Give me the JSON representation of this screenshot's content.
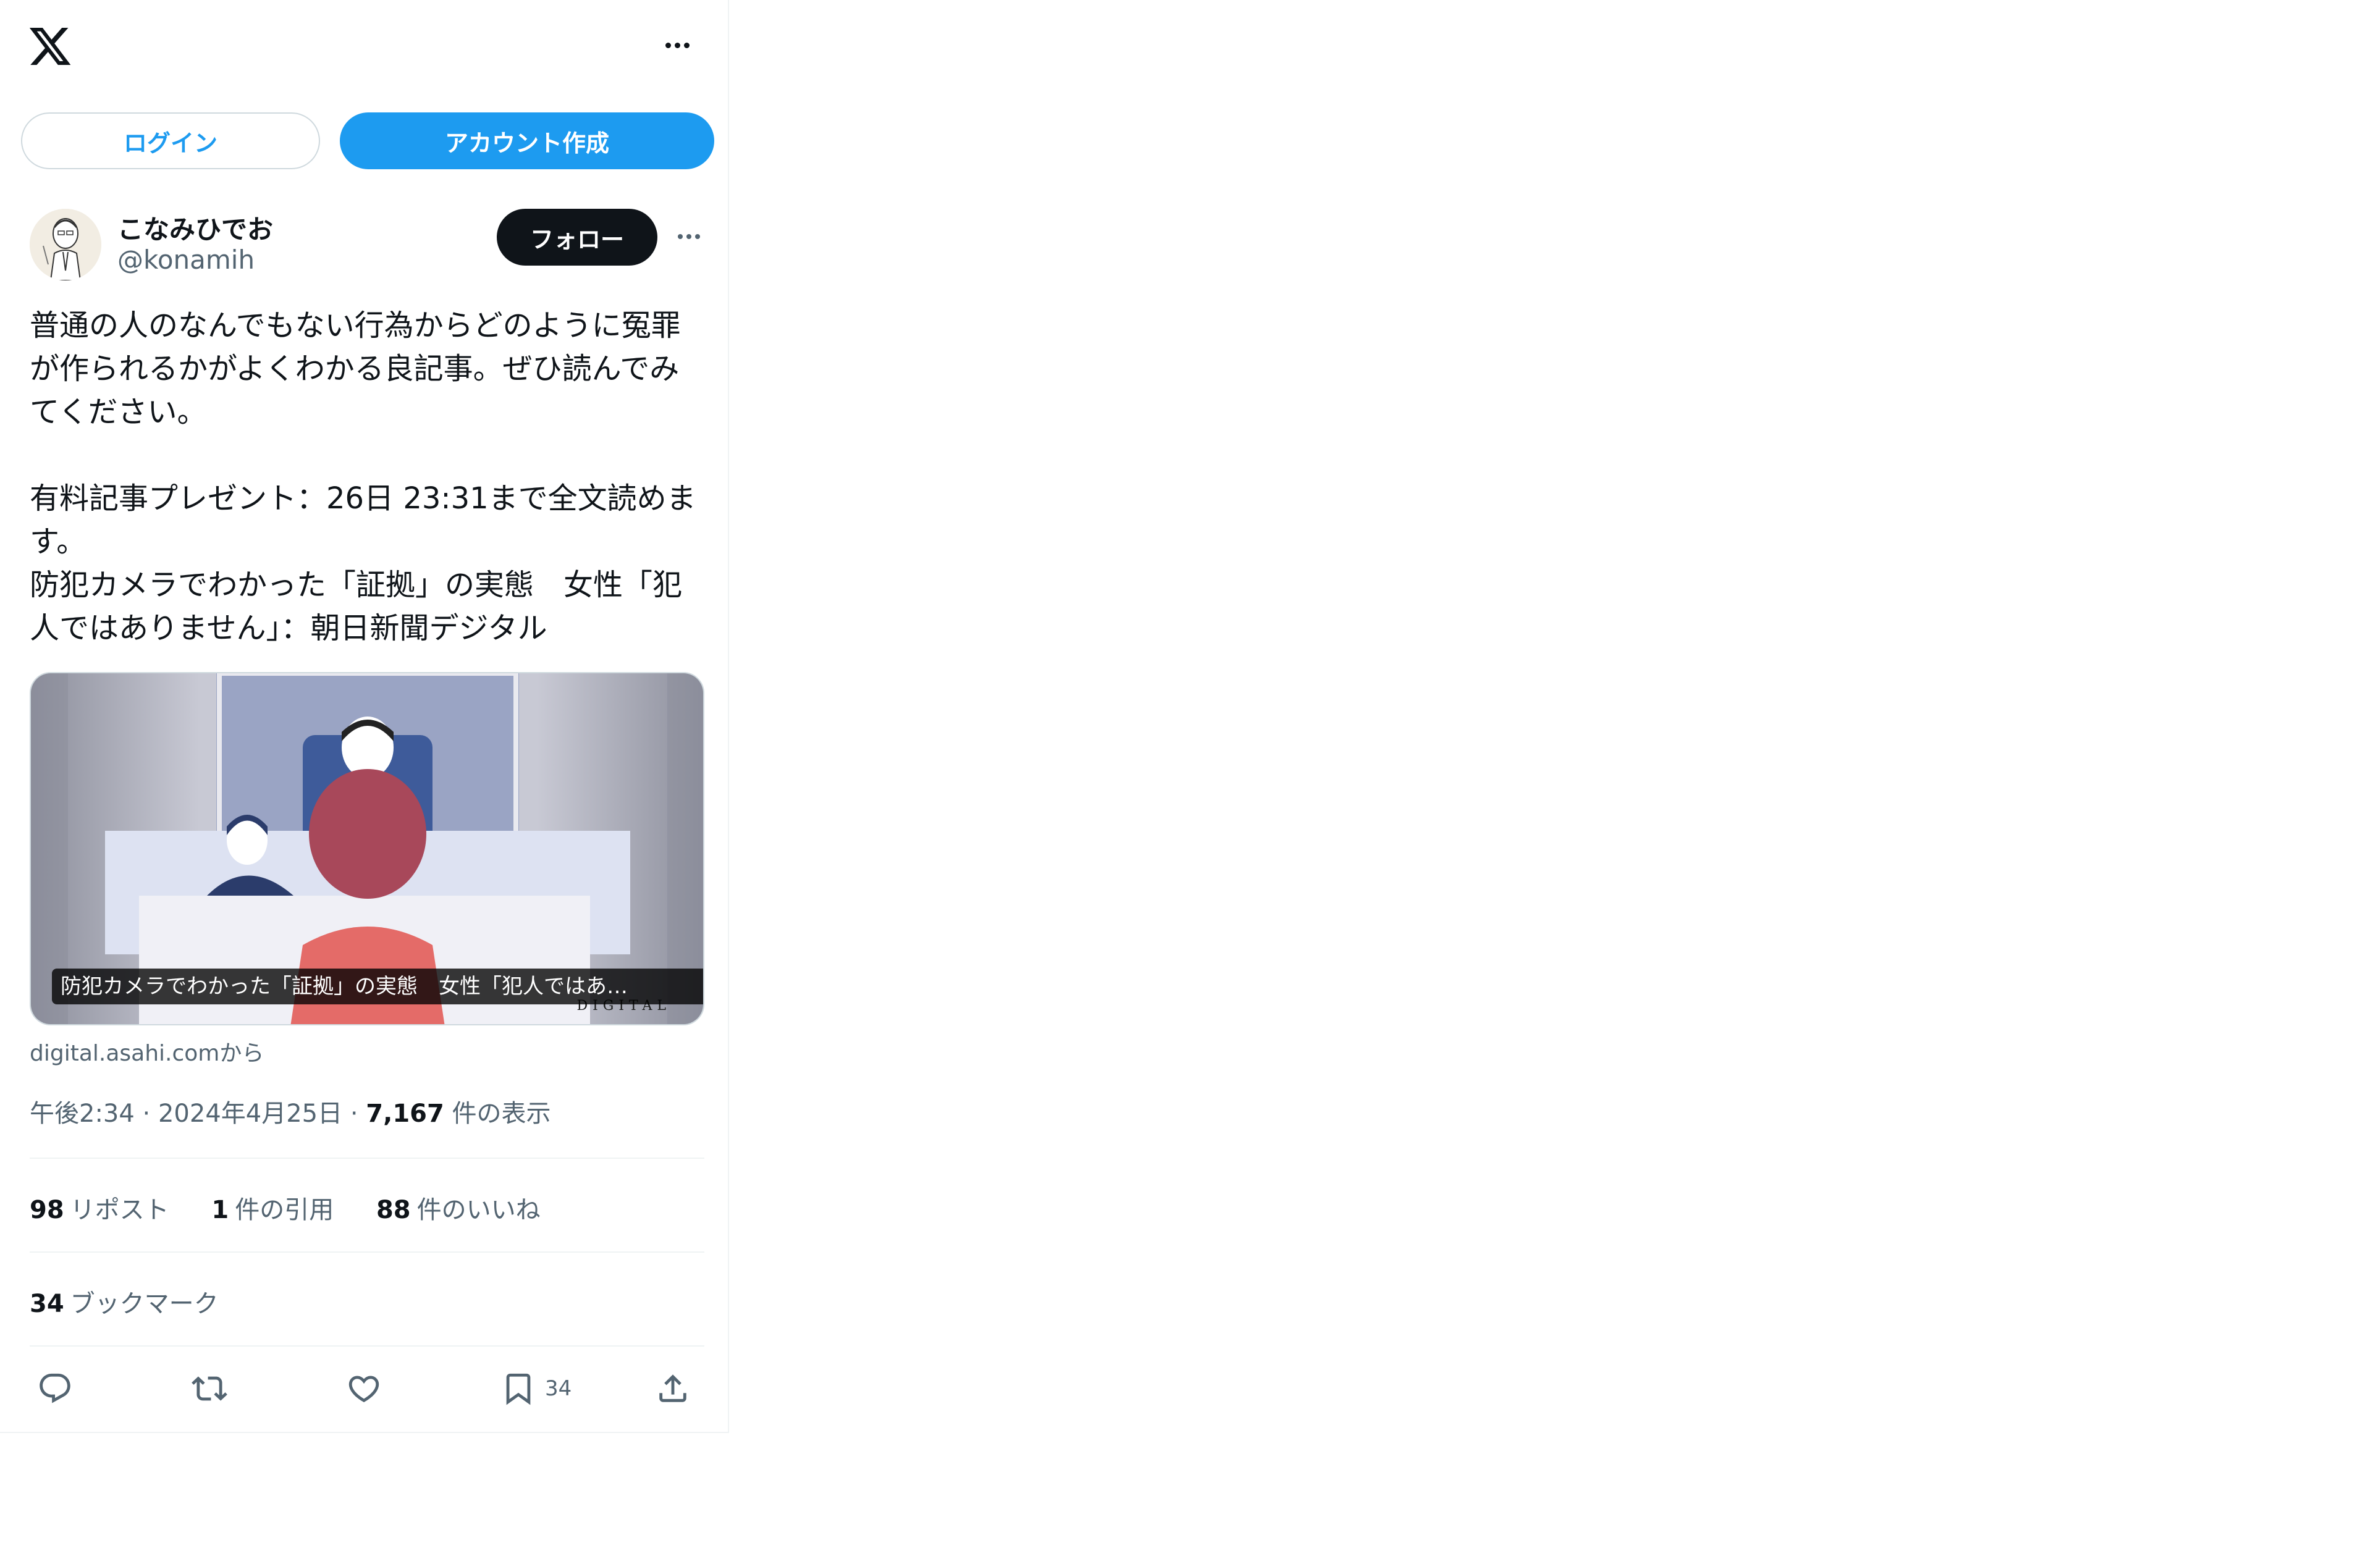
{
  "header": {
    "logo_icon": "x-logo-icon",
    "more_icon": "more-horizontal-icon"
  },
  "auth": {
    "login_label": "ログイン",
    "signup_label": "アカウント作成",
    "accent": "#1d9bf0"
  },
  "post": {
    "author": {
      "name": "こなみひでお",
      "handle": "@konamih",
      "avatar": "avatar-illustration"
    },
    "follow_label": "フォロー",
    "text": {
      "line1": "普通の人のなんでもない行為からどのように冤罪",
      "line2": "が作られるかがよくわかる良記事。ぜひ読んでみ",
      "line3": "てください。",
      "line4": "有料記事プレゼント：26日 23:31まで全文読めま",
      "line5": "す。",
      "line6": "防犯カメラでわかった「証拠」の実態　女性「犯",
      "line7": "人ではありません」：朝日新聞デジタル"
    },
    "card": {
      "caption": "防犯カメラでわかった「証拠」の実態　女性「犯人ではあ…",
      "brand": "DIGITAL",
      "source": "digital.asahi.comから"
    },
    "meta": {
      "time": "午後2:34",
      "sep1": "·",
      "date": "2024年4月25日",
      "sep2": "·",
      "views": "7,167",
      "views_label": "件の表示"
    },
    "stats": {
      "reposts": "98",
      "reposts_label": "リポスト",
      "quotes": "1",
      "quotes_label": "件の引用",
      "likes": "88",
      "likes_label": "件のいいね",
      "bookmarks": "34",
      "bookmarks_label": "ブックマーク"
    },
    "actions": {
      "reply_icon": "reply-icon",
      "repost_icon": "repost-icon",
      "like_icon": "heart-icon",
      "bookmark_icon": "bookmark-icon",
      "bookmark_count": "34",
      "share_icon": "share-icon"
    }
  }
}
